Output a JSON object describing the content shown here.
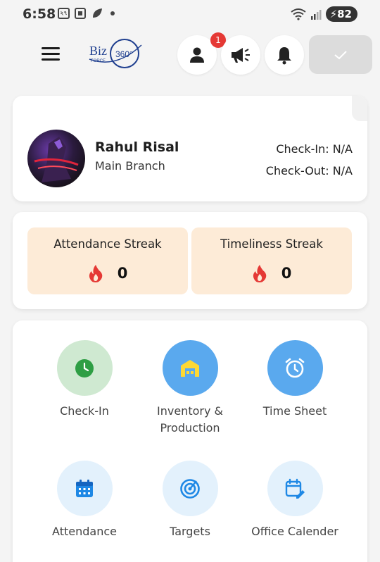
{
  "status_bar": {
    "time": "6:58",
    "indicator_label": "২৭",
    "battery": "82"
  },
  "app_bar": {
    "logo_text": "Biz",
    "logo_sub": "FORCE",
    "logo_num": "360°",
    "notification_badge": "1"
  },
  "profile": {
    "name": "Rahul Risal",
    "branch": "Main Branch",
    "check_in_label": "Check-In: ",
    "check_in_value": "N/A",
    "check_out_label": "Check-Out: ",
    "check_out_value": "N/A"
  },
  "streaks": [
    {
      "title": "Attendance Streak",
      "value": "0"
    },
    {
      "title": "Timeliness Streak",
      "value": "0"
    }
  ],
  "menu": [
    {
      "label": "Check-In",
      "icon": "clock-icon",
      "color": "#cfe9d1"
    },
    {
      "label": "Inventory &\nProduction",
      "icon": "warehouse-icon",
      "color": "#5aa9ee"
    },
    {
      "label": "Time Sheet",
      "icon": "alarm-clock-icon",
      "color": "#5aa9ee"
    },
    {
      "label": "Attendance",
      "icon": "calendar-icon",
      "color": "#e3f1fc"
    },
    {
      "label": "Targets",
      "icon": "target-icon",
      "color": "#e3f1fc"
    },
    {
      "label": "Office Calender",
      "icon": "calendar-edit-icon",
      "color": "#e3f1fc"
    }
  ],
  "colors": {
    "streak_bg": "#fdebd7",
    "flame": "#e53935",
    "badge": "#e53935",
    "accent_blue": "#1e88e5",
    "accent_green": "#2e9e44"
  }
}
